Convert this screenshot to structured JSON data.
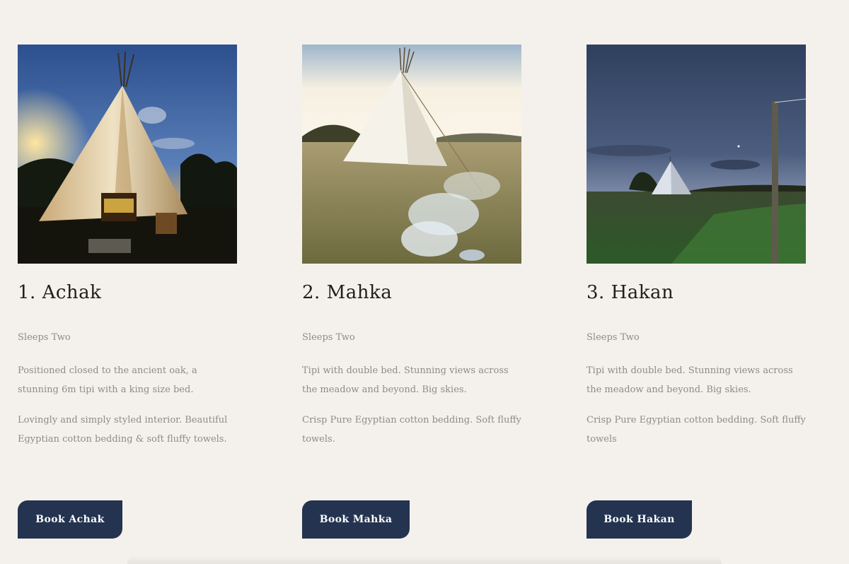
{
  "tipis": [
    {
      "title": "1. Achak",
      "sleeps": "Sleeps Two",
      "paragraphs": [
        "Positioned closed to the ancient oak, a stunning 6m tipi with a king size bed.",
        "Lovingly and simply styled interior. Beautiful Egyptian cotton bedding & soft fluffy towels."
      ],
      "button_label": "Book Achak",
      "photo_icon": "tipi-night-photo"
    },
    {
      "title": "2. Mahka",
      "sleeps": "Sleeps Two",
      "paragraphs": [
        "Tipi with double bed. Stunning views across the meadow and beyond. Big skies.",
        "Crisp Pure Egyptian cotton bedding. Soft fluffy towels."
      ],
      "button_label": "Book Mahka",
      "photo_icon": "tipi-meadow-photo"
    },
    {
      "title": "3. Hakan",
      "sleeps": "Sleeps Two",
      "paragraphs": [
        "Tipi with double bed. Stunning views across the meadow and beyond. Big skies.",
        "Crisp Pure Egyptian cotton bedding. Soft fluffy towels"
      ],
      "button_label": "Book Hakan",
      "photo_icon": "tipi-dusk-photo"
    }
  ],
  "colors": {
    "background": "#f4f1ec",
    "button": "#243350",
    "title_text": "#1f1f1f",
    "body_text": "#8f8a84"
  }
}
